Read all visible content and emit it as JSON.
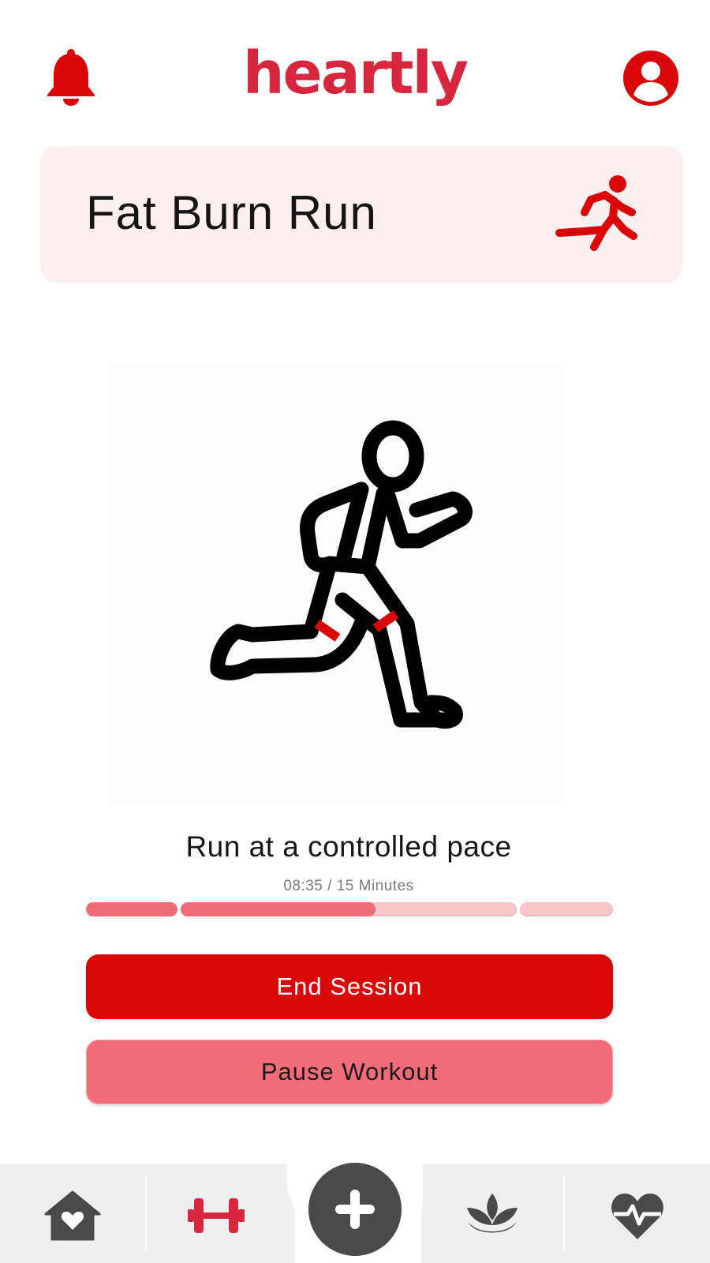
{
  "header": {
    "brand": "heartly",
    "bell_icon": "bell-icon",
    "profile_icon": "user-circle-icon"
  },
  "workout": {
    "title": "Fat Burn Run",
    "title_icon": "running-person-icon",
    "illustration": "runner-illustration",
    "instruction": "Run at a controlled pace",
    "timer": "08:35 / 15 Minutes",
    "progress_segments": [
      {
        "fill": 1.0
      },
      {
        "fill": 0.58
      },
      {
        "fill": 0.0
      },
      {
        "fill": 0.0
      }
    ]
  },
  "actions": {
    "end_label": "End Session",
    "pause_label": "Pause Workout"
  },
  "nav": {
    "items": [
      {
        "icon": "home-heart-icon",
        "active": false
      },
      {
        "icon": "dumbbell-icon",
        "active": true
      },
      {
        "icon": "plus-icon",
        "active": false
      },
      {
        "icon": "lotus-icon",
        "active": false
      },
      {
        "icon": "heart-pulse-icon",
        "active": false
      }
    ]
  },
  "colors": {
    "brand": "#d7263d",
    "primary_button": "#d90708",
    "secondary_button": "#f26b78",
    "card_bg": "#fcefef",
    "progress_fill": "#ee6b78",
    "progress_track": "#f7c6c9",
    "nav_icon": "#4a4a4a"
  }
}
